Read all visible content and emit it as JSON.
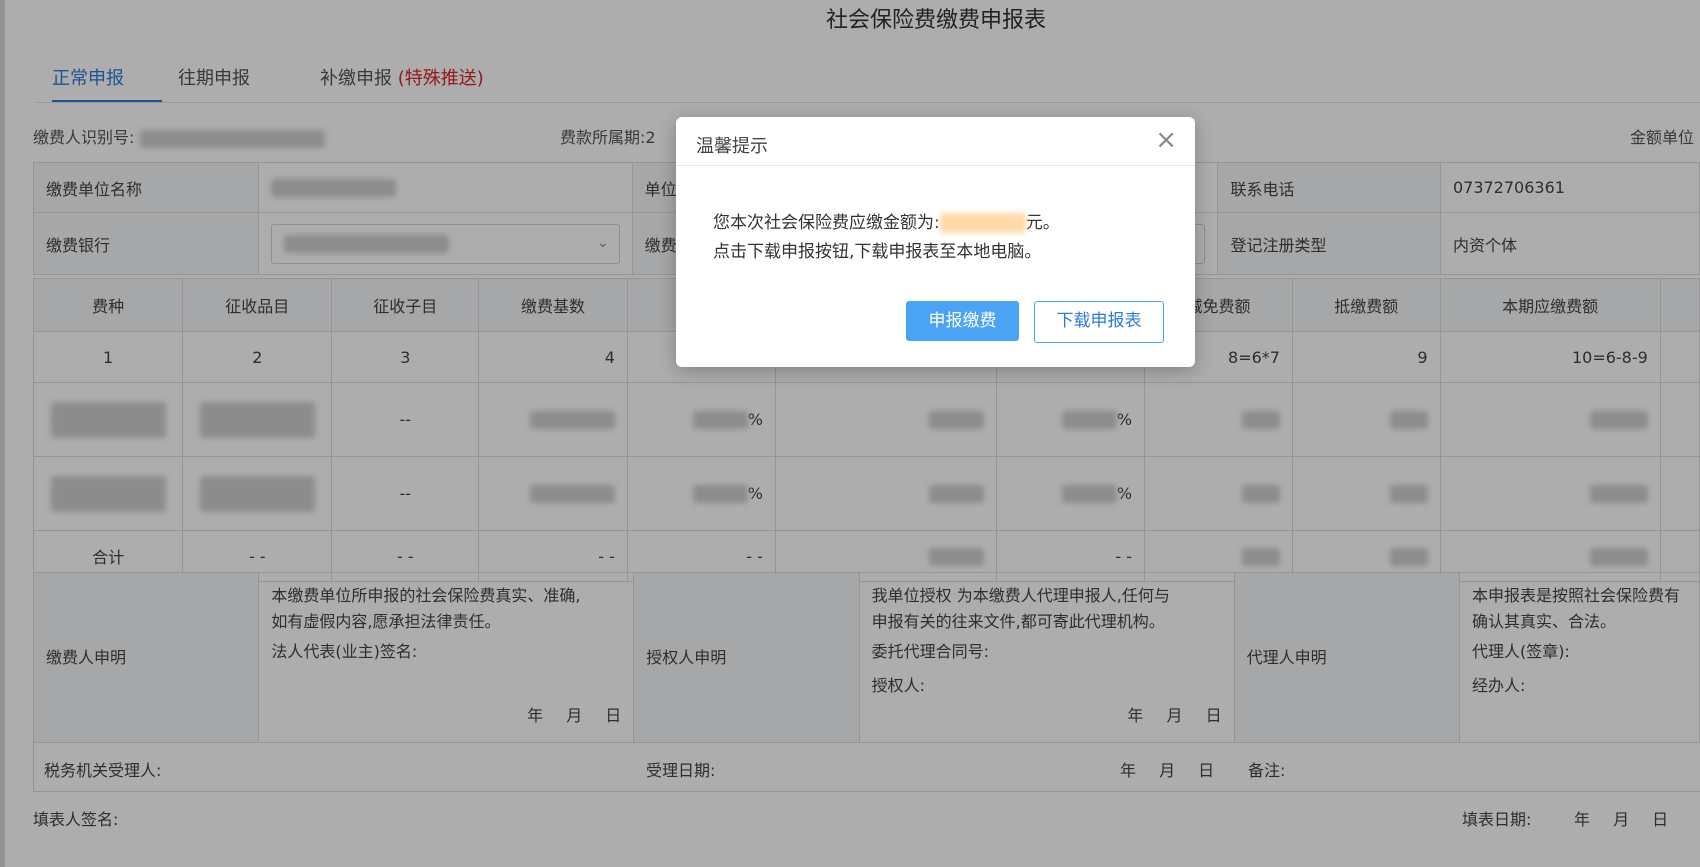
{
  "page": {
    "title": "社会保险费缴费申报表"
  },
  "tabs": [
    {
      "label": "正常申报"
    },
    {
      "label": "往期申报"
    },
    {
      "label": "补缴申报",
      "suffix": "(特殊推送)"
    }
  ],
  "meta": {
    "payer_id_label": "缴费人识别号:",
    "period_label": "费款所属期:",
    "period_prefix": "2",
    "amount_unit_label": "金额单位"
  },
  "form": {
    "unit_name_label": "缴费单位名称",
    "unit_partial_label": "单位",
    "phone_label": "联系电话",
    "phone_value": "07372706361",
    "bank_label": "缴费银行",
    "bank_partial_label": "缴费",
    "reg_type_label": "登记注册类型",
    "reg_type_value": "内资个体"
  },
  "grid": {
    "headers": [
      "费种",
      "征收品目",
      "征收子目",
      "缴费基数",
      "",
      "",
      "",
      "减免费额",
      "抵缴费额",
      "本期应缴费额"
    ],
    "index_row": [
      "1",
      "2",
      "3",
      "4",
      "",
      "",
      "",
      "8=6*7",
      "9",
      "10=6-8-9"
    ],
    "dash": "--",
    "percent": "%",
    "total_label": "合计",
    "total_dash": "- -"
  },
  "declaration": {
    "payer_label": "缴费人申明",
    "payer_text_1": "本缴费单位所申报的社会保险费真实、准确,",
    "payer_text_2": "如有虚假内容,愿承担法律责任。",
    "legal_rep": "法人代表(业主)签名:",
    "date_text": "年 月 日",
    "auth_label": "授权人申明",
    "auth_text_1": "我单位授权 为本缴费人代理申报人,任何与",
    "auth_text_2": "申报有关的往来文件,都可寄此代理机构。",
    "contract_no": "委托代理合同号:",
    "authorizer": "授权人:",
    "agent_label": "代理人申明",
    "agent_text_1": "本申报表是按照社会保险费有",
    "agent_text_2": "确认其真实、合法。",
    "agent_sign": "代理人(签章):",
    "handler": "经办人:"
  },
  "footer": {
    "tax_receiver": "税务机关受理人:",
    "accept_date": "受理日期:",
    "remark": "备注:",
    "filler_sign": "填表人签名:",
    "fill_date": "填表日期:"
  },
  "dialog": {
    "title": "温馨提示",
    "line1_prefix": "您本次社会保险费应缴金额为:",
    "line1_suffix": "元。",
    "line2": "点击下载申报按钮,下载申报表至本地电脑。",
    "primary_button": "申报缴费",
    "secondary_button": "下载申报表",
    "close_glyph": "×"
  },
  "colors": {
    "accent": "#2f7ad8",
    "primary_button": "#4aa3f3",
    "special_red": "#d9252b"
  }
}
